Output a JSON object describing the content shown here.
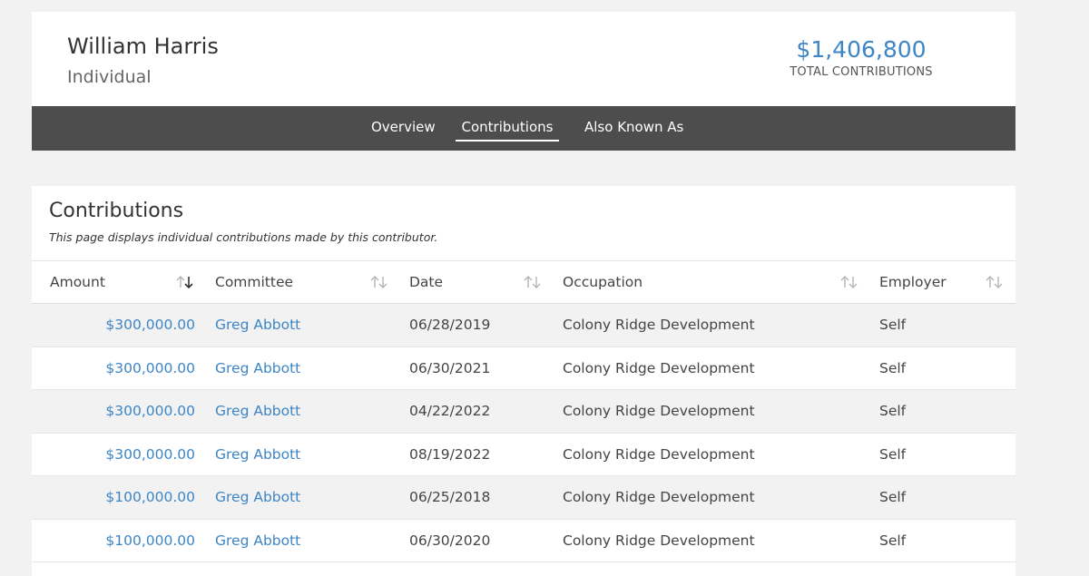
{
  "profile": {
    "name": "William Harris",
    "type": "Individual",
    "total_value": "$1,406,800",
    "total_label": "TOTAL CONTRIBUTIONS"
  },
  "nav": {
    "tabs": [
      {
        "label": "Overview",
        "active": false
      },
      {
        "label": "Contributions",
        "active": true
      },
      {
        "label": "Also Known As",
        "active": false
      }
    ]
  },
  "contributions": {
    "title": "Contributions",
    "description": "This page displays individual contributions made by this contributor.",
    "columns": [
      {
        "label": "Amount",
        "sort_icon": "sort-descending-icon"
      },
      {
        "label": "Committee",
        "sort_icon": "sort-icon"
      },
      {
        "label": "Date",
        "sort_icon": "sort-icon"
      },
      {
        "label": "Occupation",
        "sort_icon": "sort-icon"
      },
      {
        "label": "Employer",
        "sort_icon": "sort-icon"
      }
    ],
    "rows": [
      {
        "amount": "$300,000.00",
        "committee": "Greg Abbott",
        "date": "06/28/2019",
        "occupation": "Colony Ridge Development",
        "employer": "Self"
      },
      {
        "amount": "$300,000.00",
        "committee": "Greg Abbott",
        "date": "06/30/2021",
        "occupation": "Colony Ridge Development",
        "employer": "Self"
      },
      {
        "amount": "$300,000.00",
        "committee": "Greg Abbott",
        "date": "04/22/2022",
        "occupation": "Colony Ridge Development",
        "employer": "Self"
      },
      {
        "amount": "$300,000.00",
        "committee": "Greg Abbott",
        "date": "08/19/2022",
        "occupation": "Colony Ridge Development",
        "employer": "Self"
      },
      {
        "amount": "$100,000.00",
        "committee": "Greg Abbott",
        "date": "06/25/2018",
        "occupation": "Colony Ridge Development",
        "employer": "Self"
      },
      {
        "amount": "$100,000.00",
        "committee": "Greg Abbott",
        "date": "06/30/2020",
        "occupation": "Colony Ridge Development",
        "employer": "Self"
      }
    ]
  },
  "colors": {
    "link": "#3d85c6",
    "navbar": "#4d4d4d",
    "row_alt": "#f2f2f2"
  }
}
